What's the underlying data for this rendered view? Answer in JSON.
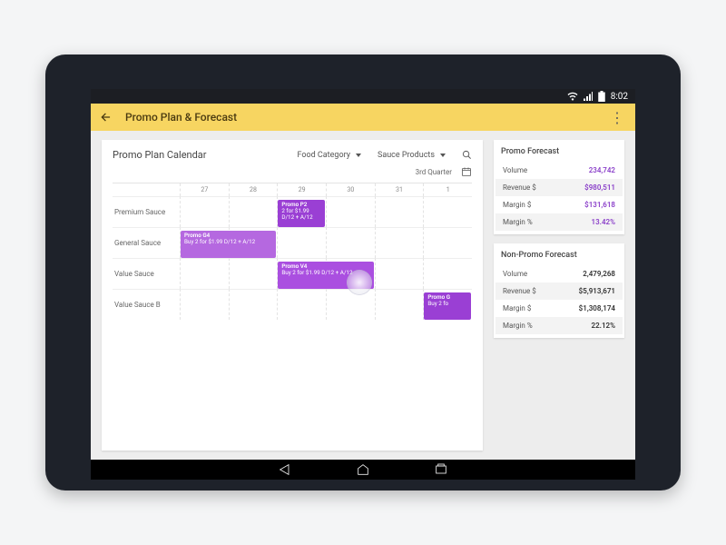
{
  "status": {
    "time": "8:02"
  },
  "appbar": {
    "title": "Promo Plan & Forecast"
  },
  "calendar": {
    "title": "Promo Plan Calendar",
    "filter1": "Food Category",
    "filter2": "Sauce Products",
    "period": "3rd Quarter",
    "cols": [
      "27",
      "28",
      "29",
      "30",
      "31",
      "1"
    ],
    "rows": [
      "Premium Sauce",
      "General Sauce",
      "Value Sauce",
      "Value Sauce B"
    ],
    "bars": [
      {
        "row": 0,
        "colStart": 3,
        "colSpan": 1,
        "color": "#9a3fd4",
        "title": "Promo P2",
        "sub": "2 for $1.99 D/12 + A/12"
      },
      {
        "row": 1,
        "colStart": 1,
        "colSpan": 2,
        "color": "#b568e0",
        "title": "Promo G4",
        "sub": "Buy 2 for $1.99 D/12 + A/12"
      },
      {
        "row": 2,
        "colStart": 3,
        "colSpan": 2,
        "color": "#aa4fe0",
        "title": "Promo V4",
        "sub": "Buy 2 for $1.99 D/12 + A/12"
      },
      {
        "row": 3,
        "colStart": 6,
        "colSpan": 1,
        "color": "#9a3fd4",
        "title": "Promo G",
        "sub": "Buy 2 fo"
      }
    ]
  },
  "forecast": {
    "promo": {
      "title": "Promo Forecast",
      "rows": [
        {
          "label": "Volume",
          "value": "234,742",
          "shade": false
        },
        {
          "label": "Revenue $",
          "value": "$980,511",
          "shade": true
        },
        {
          "label": "Margin $",
          "value": "$131,618",
          "shade": false
        },
        {
          "label": "Margin %",
          "value": "13.42%",
          "shade": true
        }
      ]
    },
    "nonpromo": {
      "title": "Non-Promo Forecast",
      "rows": [
        {
          "label": "Volume",
          "value": "2,479,268",
          "shade": false
        },
        {
          "label": "Revenue $",
          "value": "$5,913,671",
          "shade": true
        },
        {
          "label": "Margin $",
          "value": "$1,308,174",
          "shade": false
        },
        {
          "label": "Margin %",
          "value": "22.12%",
          "shade": true
        }
      ]
    }
  }
}
